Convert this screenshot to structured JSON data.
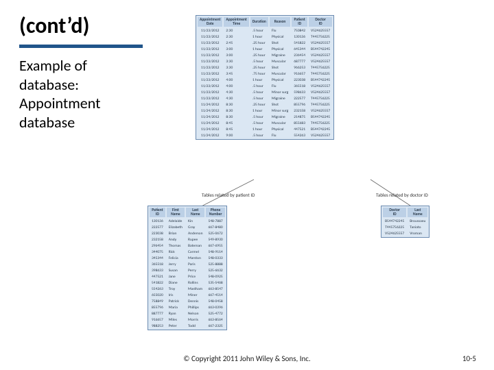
{
  "title": "(cont’d)",
  "subtitle": "Example of\ndatabase:\nAppointment\ndatabase",
  "footer": {
    "copy": "© Copyright 2011 John Wiley & Sons, Inc.",
    "page": "10-5"
  },
  "links": {
    "patient": "Tables related by patient ID",
    "doctor": "Tables related by doctor ID"
  },
  "appointments": {
    "headers": [
      "Appointment\nDate",
      "Appointment\nTime",
      "Duration",
      "Reason",
      "Patient\nID",
      "Doctor\nID"
    ],
    "rows": [
      [
        "11/23/2012",
        "2:30",
        ".5 hour",
        "Flu",
        "750842",
        "V524625557"
      ],
      [
        "11/23/2012",
        "2:30",
        "1 hour",
        "Physical",
        "130136",
        "T445756225"
      ],
      [
        "11/23/2012",
        "2:45",
        ".25 hour",
        "Shot",
        "541822",
        "V524625557"
      ],
      [
        "11/23/2012",
        "3:00",
        "1 hour",
        "Physical",
        "645344",
        "B544742245"
      ],
      [
        "11/23/2012",
        "3:00",
        ".25 hour",
        "Migraine",
        "236454",
        "V524625557"
      ],
      [
        "11/23/2012",
        "3:30",
        ".5 hour",
        "Muscular",
        "687777",
        "V524625557"
      ],
      [
        "11/23/2012",
        "3:30",
        ".25 hour",
        "Shot",
        "966253",
        "T445756225"
      ],
      [
        "11/23/2012",
        "3:45",
        ".75 hour",
        "Muscular",
        "916657",
        "T445756225"
      ],
      [
        "11/23/2012",
        "4:00",
        "1 hour",
        "Physical",
        "223038",
        "B544742245"
      ],
      [
        "11/23/2012",
        "4:00",
        ".5 hour",
        "Flu",
        "365518",
        "V524625557"
      ],
      [
        "11/23/2012",
        "4:30",
        ".5 hour",
        "Minor surg",
        "598633",
        "V524625557"
      ],
      [
        "11/23/2012",
        "4:30",
        ".5 hour",
        "Migraine",
        "222577",
        "T445756225"
      ],
      [
        "11/24/2012",
        "8:30",
        ".25 hour",
        "Shot",
        "855796",
        "T445756225"
      ],
      [
        "11/24/2012",
        "8:30",
        "1 hour",
        "Minor surg",
        "232158",
        "V524625557"
      ],
      [
        "11/24/2012",
        "8:30",
        ".5 hour",
        "Migraine",
        "214875",
        "B544742245"
      ],
      [
        "11/24/2012",
        "8:45",
        ".5 hour",
        "Muscular",
        "855683",
        "T445756225"
      ],
      [
        "11/24/2012",
        "8:45",
        "1 hour",
        "Physical",
        "447521",
        "B544742245"
      ],
      [
        "11/24/2012",
        "9:00",
        ".5 hour",
        "Flu",
        "554263",
        "V524625557"
      ]
    ]
  },
  "patients": {
    "headers": [
      "Patient\nID",
      "First\nName",
      "Last\nName",
      "Phone\nNumber"
    ],
    "rows": [
      [
        "130136",
        "Adelaide",
        "Kin",
        "548-7887"
      ],
      [
        "222577",
        "Elizabeth",
        "Gray",
        "667-8480"
      ],
      [
        "223038",
        "Brian",
        "Anderson",
        "525-0672"
      ],
      [
        "232158",
        "Andy",
        "Rupee",
        "549-8930"
      ],
      [
        "296454",
        "Thomas",
        "Bateman",
        "667-6955"
      ],
      [
        "344075",
        "Rick",
        "Carmel",
        "548-9114"
      ],
      [
        "345344",
        "Felicia",
        "Marston",
        "548-0333"
      ],
      [
        "365518",
        "Jerry",
        "Paris",
        "525-8888"
      ],
      [
        "398633",
        "Susan",
        "Perry",
        "525-6632"
      ],
      [
        "447521",
        "Jane",
        "Price",
        "548-0925"
      ],
      [
        "541822",
        "Diane",
        "Rollins",
        "535-5468"
      ],
      [
        "554263",
        "Troy",
        "Mastham",
        "663-8547"
      ],
      [
        "655020",
        "Iris",
        "Miner",
        "667-4514"
      ],
      [
        "758849",
        "Patrick",
        "Dennis",
        "548-0458"
      ],
      [
        "855796",
        "Maria",
        "Phillips",
        "663-0396"
      ],
      [
        "887777",
        "Ryan",
        "Nelson",
        "525-4772"
      ],
      [
        "916657",
        "Miles",
        "Morris",
        "663-8564"
      ],
      [
        "988253",
        "Peter",
        "Todd",
        "667-2325"
      ]
    ]
  },
  "doctors": {
    "headers": [
      "Doctor\nID",
      "Last\nName"
    ],
    "rows": [
      [
        "B544742245",
        "Broussaeu"
      ],
      [
        "T445756225",
        "Taniato"
      ],
      [
        "V524625557",
        "Vroman"
      ]
    ]
  }
}
